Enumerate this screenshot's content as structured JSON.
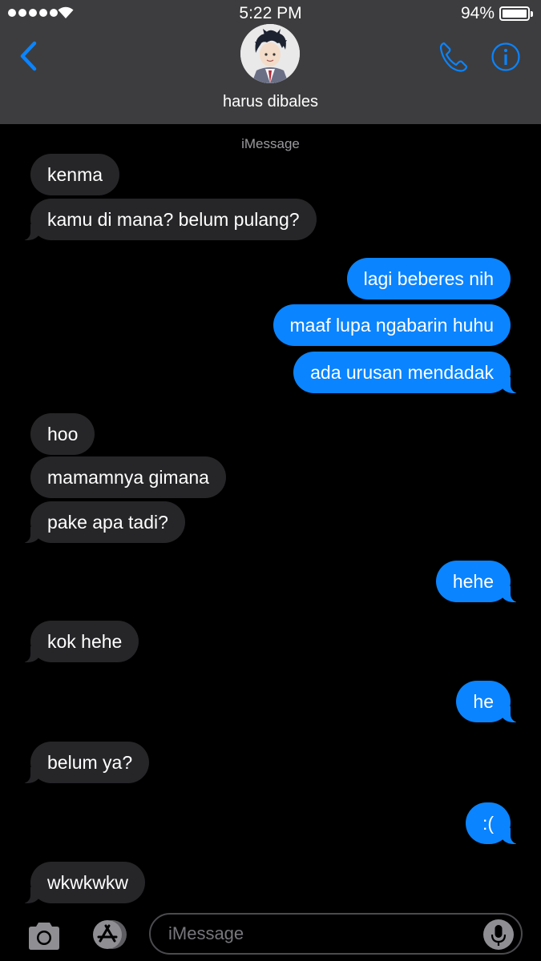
{
  "status_bar": {
    "time": "5:22 PM",
    "battery": "94%"
  },
  "header": {
    "contact_name": "harus dibales"
  },
  "service_label": "iMessage",
  "messages": [
    {
      "side": "in",
      "text": "kenma"
    },
    {
      "side": "in",
      "text": "kamu di mana? belum pulang?"
    },
    {
      "side": "out",
      "text": "lagi beberes nih"
    },
    {
      "side": "out",
      "text": "maaf lupa ngabarin huhu"
    },
    {
      "side": "out",
      "text": "ada urusan mendadak"
    },
    {
      "side": "in",
      "text": "hoo"
    },
    {
      "side": "in",
      "text": "mamamnya gimana"
    },
    {
      "side": "in",
      "text": "pake apa tadi?"
    },
    {
      "side": "out",
      "text": "hehe"
    },
    {
      "side": "in",
      "text": "kok hehe"
    },
    {
      "side": "out",
      "text": "he"
    },
    {
      "side": "in",
      "text": "belum ya?"
    },
    {
      "side": "out",
      "text": ":("
    },
    {
      "side": "in",
      "text": "wkwkwkw"
    }
  ],
  "input": {
    "placeholder": "iMessage"
  },
  "colors": {
    "header_bg": "#3d3d3f",
    "incoming_bubble": "#262629",
    "outgoing_bubble": "#0a84ff",
    "accent": "#0a84ff"
  }
}
